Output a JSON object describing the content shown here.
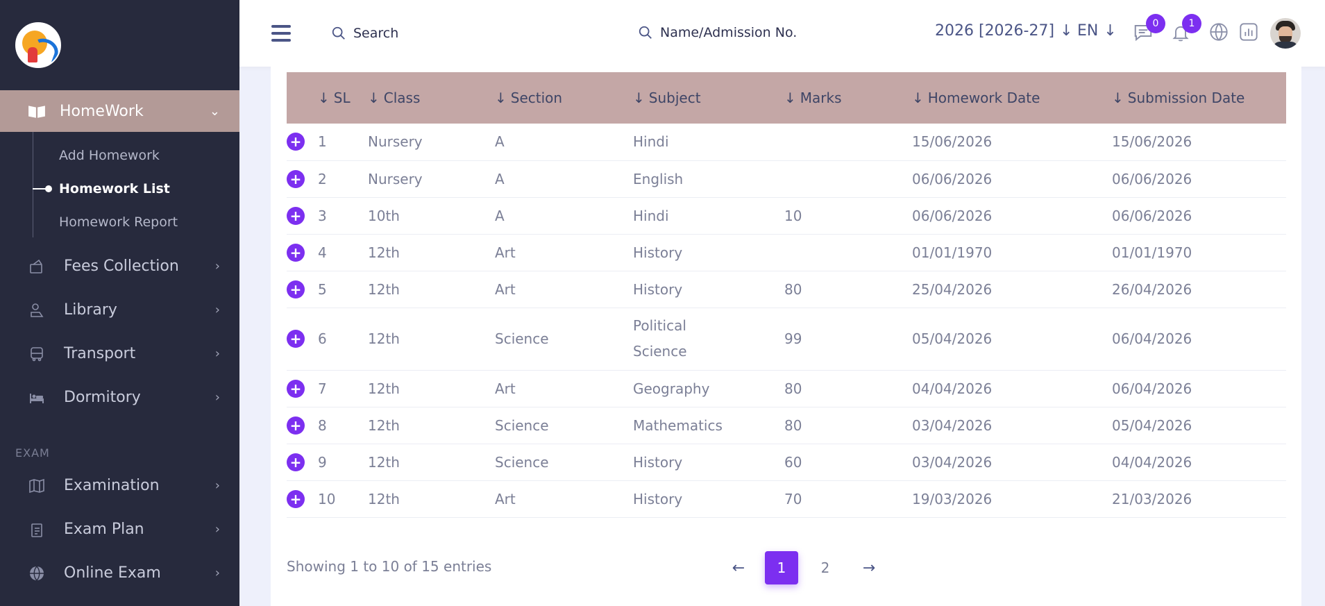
{
  "sidebar": {
    "active": {
      "label": "HomeWork"
    },
    "subitems": [
      {
        "label": "Add Homework"
      },
      {
        "label": "Homework List"
      },
      {
        "label": "Homework Report"
      }
    ],
    "items": [
      {
        "label": "Fees Collection",
        "icon": "fees-icon"
      },
      {
        "label": "Library",
        "icon": "library-icon"
      },
      {
        "label": "Transport",
        "icon": "bus-icon"
      },
      {
        "label": "Dormitory",
        "icon": "bed-icon"
      }
    ],
    "section_exam": "EXAM",
    "exam_items": [
      {
        "label": "Examination",
        "icon": "map-icon"
      },
      {
        "label": "Exam Plan",
        "icon": "clipboard-icon"
      },
      {
        "label": "Online Exam",
        "icon": "globe-icon"
      }
    ]
  },
  "topbar": {
    "search_label": "Search",
    "student_search_label": "Name/Admission No.",
    "year": "2026 [2026-27]",
    "lang": "EN",
    "messages_count": "0",
    "notifications_count": "1"
  },
  "table": {
    "headers": [
      "SL",
      "Class",
      "Section",
      "Subject",
      "Marks",
      "Homework Date",
      "Submission Date"
    ],
    "rows": [
      [
        "1",
        "Nursery",
        "A",
        "Hindi",
        "",
        "15/06/2026",
        "15/06/2026"
      ],
      [
        "2",
        "Nursery",
        "A",
        "English",
        "",
        "06/06/2026",
        "06/06/2026"
      ],
      [
        "3",
        "10th",
        "A",
        "Hindi",
        "10",
        "06/06/2026",
        "06/06/2026"
      ],
      [
        "4",
        "12th",
        "Art",
        "History",
        "",
        "01/01/1970",
        "01/01/1970"
      ],
      [
        "5",
        "12th",
        "Art",
        "History",
        "80",
        "25/04/2026",
        "26/04/2026"
      ],
      [
        "6",
        "12th",
        "Science",
        "Political Science",
        "99",
        "05/04/2026",
        "06/04/2026"
      ],
      [
        "7",
        "12th",
        "Art",
        "Geography",
        "80",
        "04/04/2026",
        "06/04/2026"
      ],
      [
        "8",
        "12th",
        "Science",
        "Mathematics",
        "80",
        "03/04/2026",
        "05/04/2026"
      ],
      [
        "9",
        "12th",
        "Science",
        "History",
        "60",
        "03/04/2026",
        "04/04/2026"
      ],
      [
        "10",
        "12th",
        "Art",
        "History",
        "70",
        "19/03/2026",
        "21/03/2026"
      ]
    ]
  },
  "footer": {
    "info": "Showing 1 to 10 of 15 entries",
    "pages": [
      "1",
      "2"
    ],
    "active_page": "1"
  }
}
